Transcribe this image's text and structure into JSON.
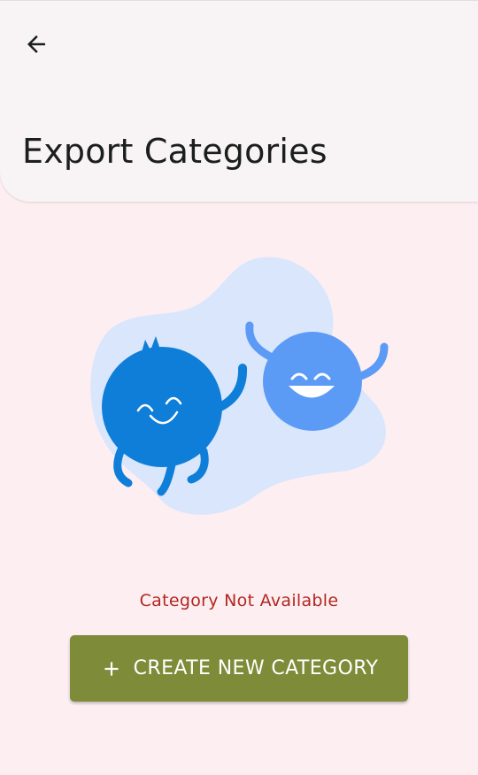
{
  "header": {
    "back_icon": "arrow-left-icon",
    "title": "Export Categories"
  },
  "empty_state": {
    "illustration": "two-happy-blobs-waving",
    "message": "Category Not Available"
  },
  "actions": {
    "create_icon": "plus-icon",
    "create_label": "CREATE NEW CATEGORY"
  },
  "colors": {
    "background": "#FDEEF2",
    "header": "#F8F3F5",
    "accent": "#7E8B38",
    "error_text": "#B3261E",
    "blob_primary": "#0F7ED9",
    "blob_secondary": "#5B9BF6",
    "blob_backdrop": "#D9E6FB"
  }
}
